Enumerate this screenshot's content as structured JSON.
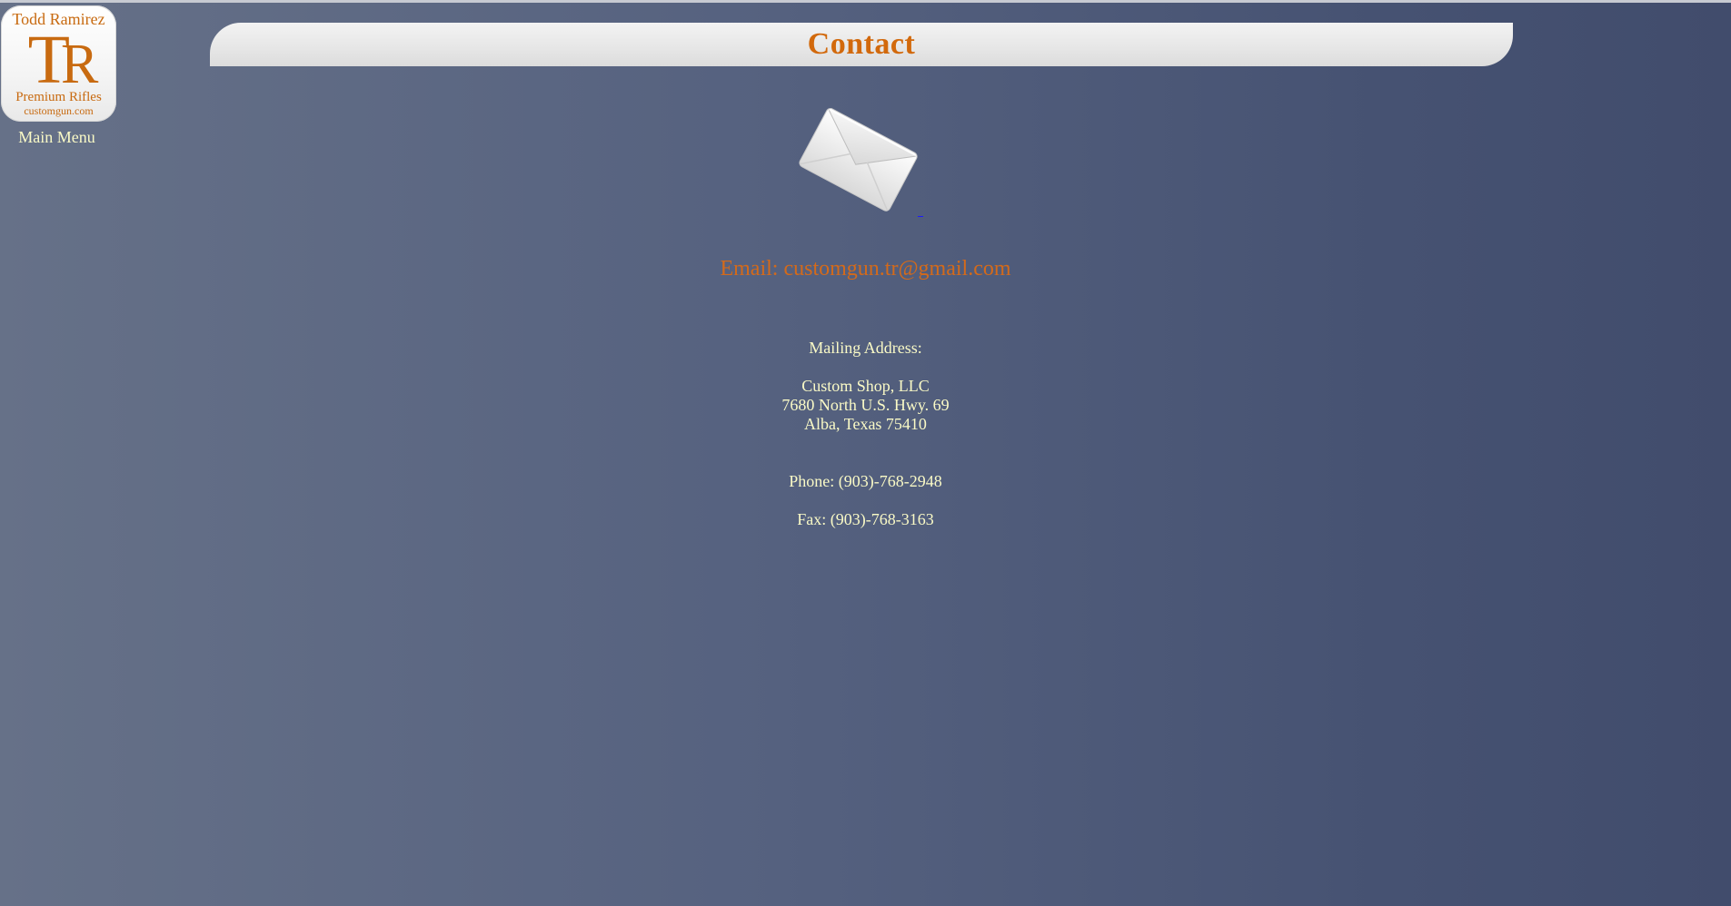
{
  "logo": {
    "name": "Todd Ramirez",
    "monogram_t": "T",
    "monogram_r": "R",
    "tagline": "Premium Rifles",
    "url": "customgun.com"
  },
  "nav": {
    "main_menu_label": "Main Menu"
  },
  "page": {
    "title": "Contact"
  },
  "contact": {
    "envelope_icon": "envelope-icon",
    "email_text": "Email: customgun.tr@gmail.com",
    "mailing_label": "Mailing Address:",
    "company": "Custom Shop, LLC",
    "street": "7680 North U.S. Hwy. 69",
    "city_state_zip": "Alba, Texas 75410",
    "phone": "Phone: (903)-768-2948",
    "fax": "Fax: (903)-768-3163"
  },
  "colors": {
    "title": "#d2690c",
    "email": "#d46a1a",
    "body_text": "#fafac6",
    "background_left": "#667188",
    "background_right": "#414c6c"
  }
}
